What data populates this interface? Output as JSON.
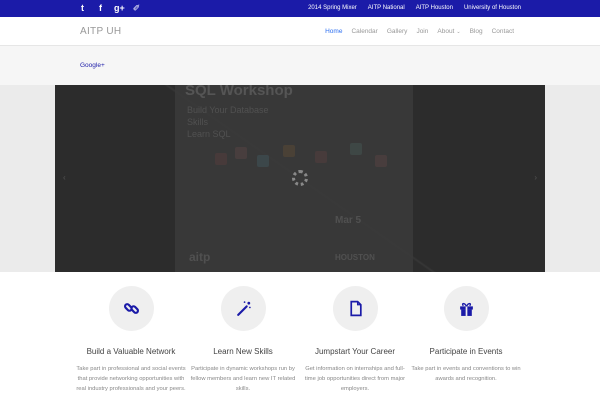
{
  "topbar": {
    "social": [
      {
        "icon": "twitter-icon",
        "glyph": "t"
      },
      {
        "icon": "facebook-icon",
        "glyph": "f"
      },
      {
        "icon": "google-plus-icon",
        "glyph": "g+"
      },
      {
        "icon": "link-icon",
        "glyph": "✐"
      }
    ],
    "links": [
      "2014 Spring Mixer",
      "AITP National",
      "AITP Houston",
      "University of Houston"
    ],
    "color": "#1b1ba8"
  },
  "header": {
    "logo": "AITP UH",
    "nav": [
      "Home",
      "Calendar",
      "Gallery",
      "Join",
      "About",
      "Blog",
      "Contact"
    ],
    "active": "Home",
    "accent": "#2d6ff0"
  },
  "subbar": {
    "link": "Google+"
  },
  "slider": {
    "poster_title": "SQL Workshop",
    "poster_lines": [
      "Build Your Database",
      "Skills",
      "Learn SQL"
    ],
    "poster_bottom_left": "aitp",
    "poster_bottom_right": "HOUSTON",
    "poster_date": "Mar 5"
  },
  "features": [
    {
      "icon": "link-icon",
      "title": "Build a Valuable Network",
      "desc": "Take part in professional and social events that provide networking opportunities with real industry professionals and your peers."
    },
    {
      "icon": "magic-wand-icon",
      "title": "Learn New Skills",
      "desc": "Participate in dynamic workshops run by fellow members and learn new IT related skills."
    },
    {
      "icon": "document-icon",
      "title": "Jumpstart Your Career",
      "desc": "Get information on internships and full-time job opportunities direct from major employers."
    },
    {
      "icon": "gift-icon",
      "title": "Participate in Events",
      "desc": "Take part in events and conventions to win awards and recognition."
    }
  ]
}
